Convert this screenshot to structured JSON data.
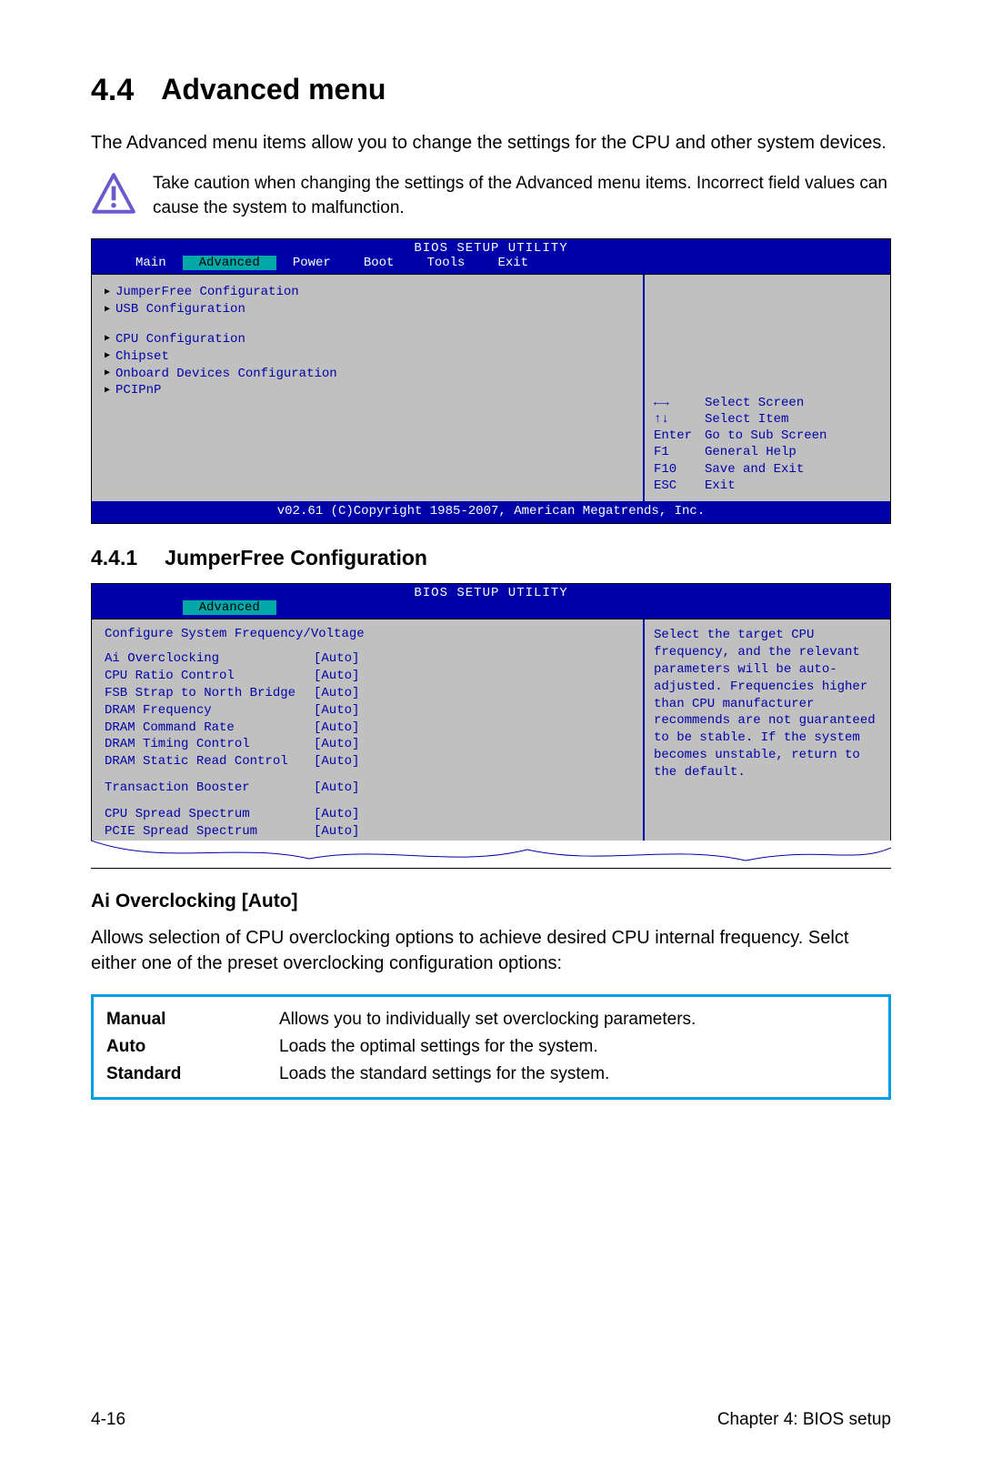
{
  "section": {
    "number": "4.4",
    "title": "Advanced menu"
  },
  "intro": "The Advanced menu items allow you to change the settings for the CPU and other system devices.",
  "caution": "Take caution when changing the settings of the Advanced menu items. Incorrect field values can cause the system to malfunction.",
  "bios1": {
    "title": "BIOS SETUP UTILITY",
    "tabs": [
      "Main",
      "Advanced",
      "Power",
      "Boot",
      "Tools",
      "Exit"
    ],
    "active_tab": "Advanced",
    "group1": [
      "JumperFree Configuration",
      "USB Configuration"
    ],
    "group2": [
      "CPU Configuration",
      "Chipset",
      "Onboard Devices Configuration",
      "PCIPnP"
    ],
    "help": [
      {
        "key": "←→",
        "desc": "Select Screen"
      },
      {
        "key": "↑↓",
        "desc": "Select Item"
      },
      {
        "key": "Enter",
        "desc": "Go to Sub Screen"
      },
      {
        "key": "F1",
        "desc": "General Help"
      },
      {
        "key": "F10",
        "desc": "Save and Exit"
      },
      {
        "key": "ESC",
        "desc": "Exit"
      }
    ],
    "footer": "v02.61 (C)Copyright 1985-2007, American Megatrends, Inc."
  },
  "subsection": {
    "number": "4.4.1",
    "title": "JumperFree Configuration"
  },
  "bios2": {
    "title": "BIOS SETUP UTILITY",
    "tab": "Advanced",
    "top_line": "Configure System Frequency/Voltage",
    "settings_a": [
      {
        "label": "Ai Overclocking",
        "value": "[Auto]"
      },
      {
        "label": "CPU Ratio Control",
        "value": "[Auto]"
      },
      {
        "label": "FSB Strap to North Bridge",
        "value": "[Auto]"
      },
      {
        "label": "DRAM Frequency",
        "value": "[Auto]"
      },
      {
        "label": "DRAM Command Rate",
        "value": "[Auto]"
      },
      {
        "label": "DRAM Timing Control",
        "value": "[Auto]"
      },
      {
        "label": "DRAM Static Read Control",
        "value": "[Auto]"
      }
    ],
    "settings_b": [
      {
        "label": "Transaction Booster",
        "value": "[Auto]"
      }
    ],
    "settings_c": [
      {
        "label": "CPU Spread Spectrum",
        "value": "[Auto]"
      },
      {
        "label": "PCIE Spread Spectrum",
        "value": "[Auto]"
      }
    ],
    "right_help": "Select the target CPU frequency, and the relevant parameters will be auto-adjusted. Frequencies higher than CPU manufacturer recommends are not guaranteed to be stable. If the system becomes unstable, return to the default."
  },
  "item": {
    "heading": "Ai Overclocking [Auto]",
    "desc": "Allows selection of CPU overclocking options to achieve desired CPU internal frequency. Selct either one of the preset overclocking configuration options:",
    "options": [
      {
        "name": "Manual",
        "desc": "Allows you to individually set overclocking parameters."
      },
      {
        "name": "Auto",
        "desc": "Loads the optimal settings for the system."
      },
      {
        "name": "Standard",
        "desc": "Loads the standard settings for the system."
      }
    ]
  },
  "footer": {
    "left": "4-16",
    "right": "Chapter 4: BIOS setup"
  }
}
